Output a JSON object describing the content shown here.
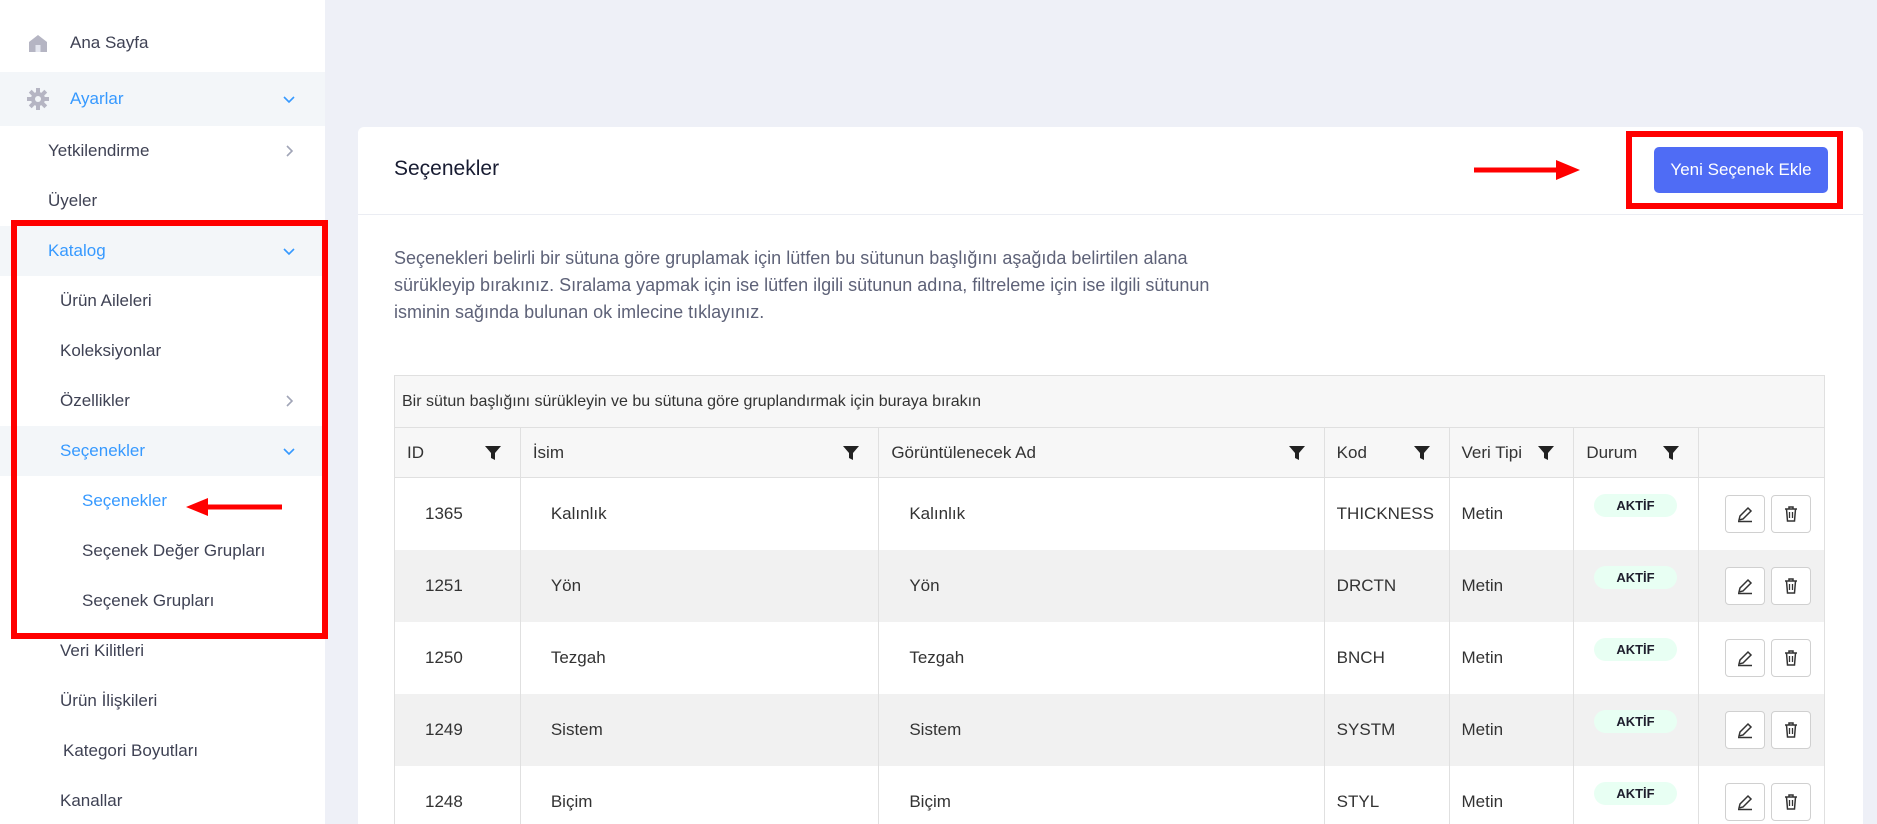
{
  "sidebar": {
    "home": "Ana Sayfa",
    "settings": "Ayarlar",
    "authorization": "Yetkilendirme",
    "members": "Üyeler",
    "catalog": "Katalog",
    "product_families": "Ürün Aileleri",
    "collections": "Koleksiyonlar",
    "features": "Özellikler",
    "options": "Seçenekler",
    "options_sub": "Seçenekler",
    "option_value_groups": "Seçenek Değer Grupları",
    "option_groups": "Seçenek Grupları",
    "data_locks": "Veri Kilitleri",
    "product_relations": "Ürün İlişkileri",
    "category_dimensions": "Kategori Boyutları",
    "channels": "Kanallar"
  },
  "main": {
    "title": "Seçenekler",
    "add_button": "Yeni Seçenek Ekle",
    "description": "Seçenekleri belirli bir sütuna göre gruplamak için lütfen bu sütunun başlığını aşağıda belirtilen alana sürükleyip bırakınız. Sıralama yapmak için ise lütfen ilgili sütunun adına, filtreleme için ise ilgili sütunun isminin sağında bulunan ok imlecine tıklayınız."
  },
  "grid": {
    "group_panel": "Bir sütun başlığını sürükleyin ve bu sütuna göre gruplandırmak için buraya bırakın",
    "columns": [
      "ID",
      "İsim",
      "Görüntülenecek Ad",
      "Kod",
      "Veri Tipi",
      "Durum",
      ""
    ],
    "rows": [
      {
        "id": "1365",
        "name": "Kalınlık",
        "display": "Kalınlık",
        "code": "THICKNESS",
        "type": "Metin",
        "status": "AKTİF"
      },
      {
        "id": "1251",
        "name": "Yön",
        "display": "Yön",
        "code": "DRCTN",
        "type": "Metin",
        "status": "AKTİF"
      },
      {
        "id": "1250",
        "name": "Tezgah",
        "display": "Tezgah",
        "code": "BNCH",
        "type": "Metin",
        "status": "AKTİF"
      },
      {
        "id": "1249",
        "name": "Sistem",
        "display": "Sistem",
        "code": "SYSTM",
        "type": "Metin",
        "status": "AKTİF"
      },
      {
        "id": "1248",
        "name": "Biçim",
        "display": "Biçim",
        "code": "STYL",
        "type": "Metin",
        "status": "AKTİF"
      }
    ]
  },
  "colors": {
    "accent": "#3699ff",
    "button": "#4f6cf5",
    "annotation": "#ff0000",
    "badge_bg": "#e8fff3"
  },
  "icons": [
    "home-icon",
    "gear-icon",
    "chevron-down-icon",
    "chevron-right-icon",
    "filter-icon",
    "edit-icon",
    "trash-icon"
  ]
}
